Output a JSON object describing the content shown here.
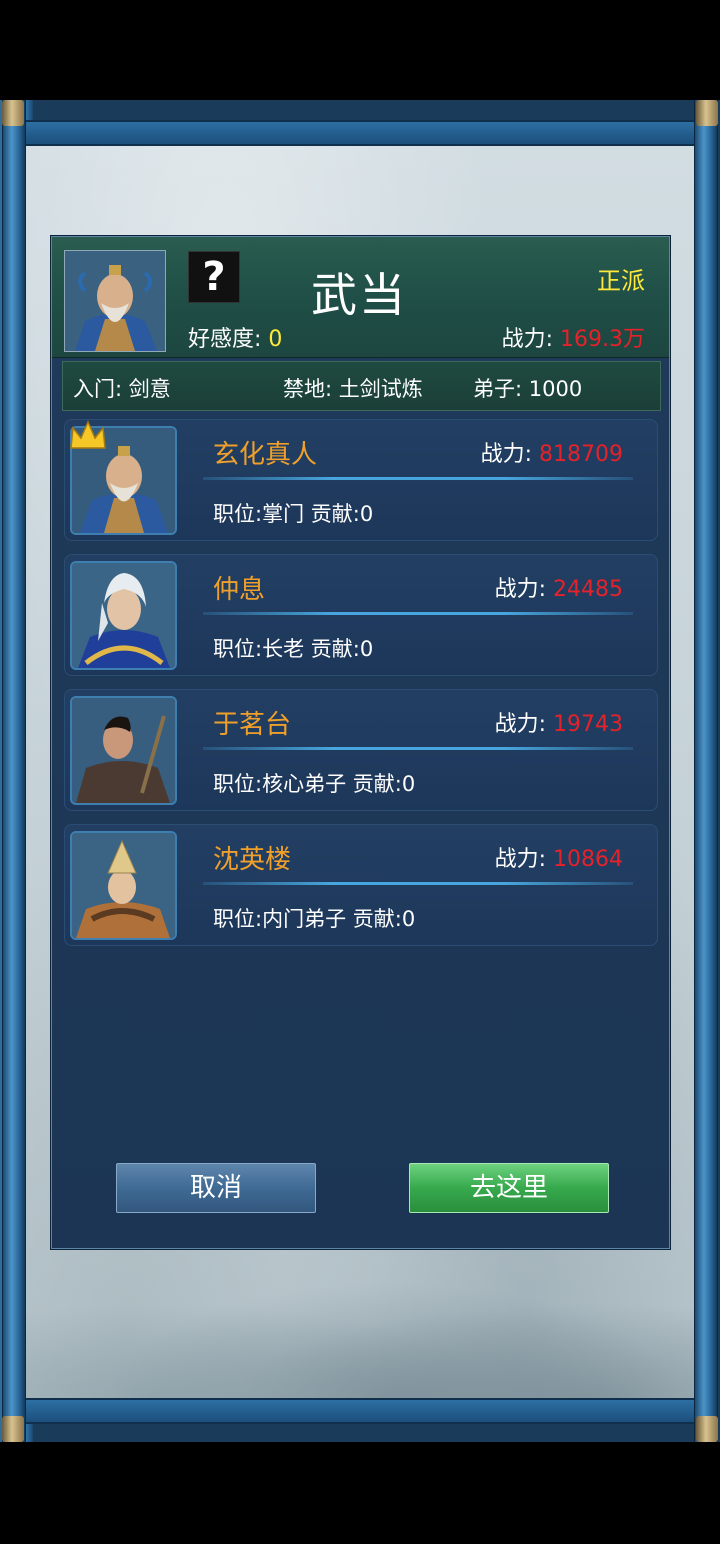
{
  "header": {
    "sect_name": "武当",
    "alignment": "正派",
    "help_glyph": "?",
    "favor_label": "好感度: ",
    "favor_value": "0",
    "power_label": "战力: ",
    "power_value": "169.3万"
  },
  "info": {
    "entry": "入门: 剑意",
    "forbidden": "禁地: 土剑试炼",
    "disciples": "弟子: 1000"
  },
  "members": [
    {
      "name": "玄化真人",
      "power_label": "战力: ",
      "power": "818709",
      "role": "职位:掌门 贡献:0"
    },
    {
      "name": "仲息",
      "power_label": "战力: ",
      "power": "24485",
      "role": "职位:长老 贡献:0"
    },
    {
      "name": "于茗台",
      "power_label": "战力: ",
      "power": "19743",
      "role": "职位:核心弟子 贡献:0"
    },
    {
      "name": "沈英楼",
      "power_label": "战力: ",
      "power": "10864",
      "role": "职位:内门弟子 贡献:0"
    }
  ],
  "buttons": {
    "cancel": "取消",
    "go": "去这里"
  },
  "colors": {
    "name": "#f0a02a",
    "power_value": "#e5222a",
    "highlight": "#ffe93a",
    "header_green": "#1f4f47",
    "panel_blue": "#1c3555"
  }
}
